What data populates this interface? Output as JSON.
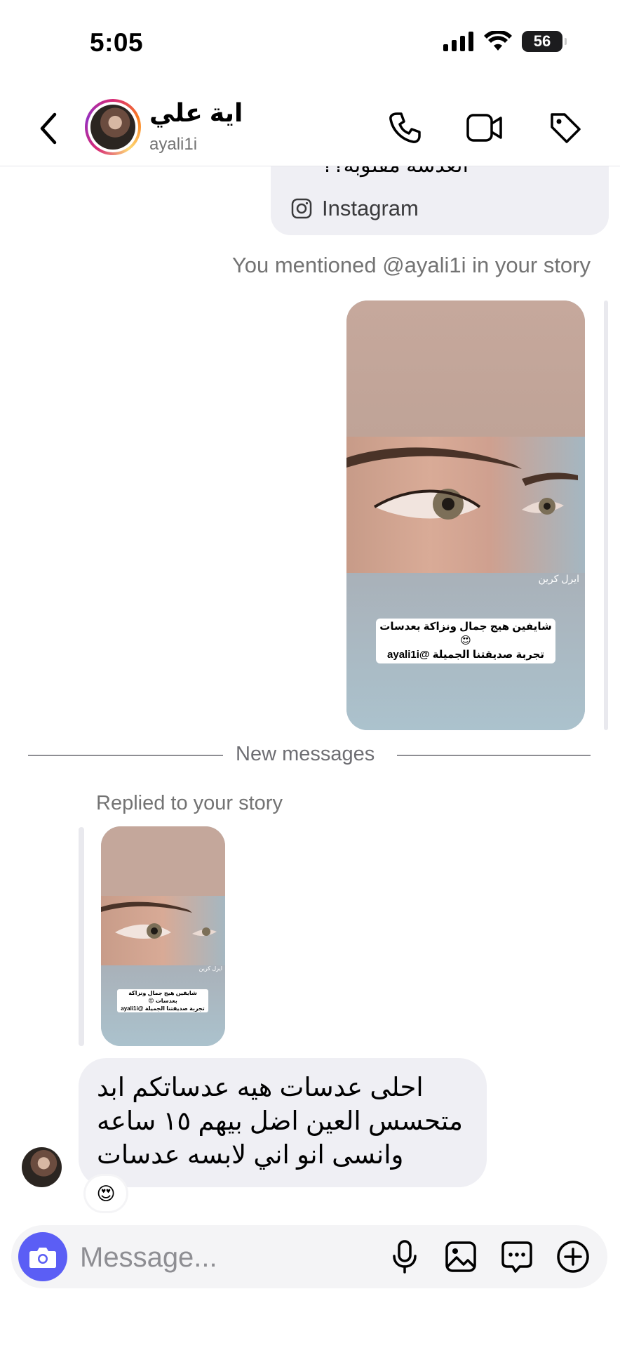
{
  "status_bar": {
    "time": "5:05",
    "battery": "56"
  },
  "header": {
    "name": "اية علي",
    "username": "ayali1i",
    "icons": [
      "back-icon",
      "phone-icon",
      "video-icon",
      "tag-icon"
    ]
  },
  "shared_post": {
    "text": "العدسة مقلوبة؟؟",
    "source": "Instagram"
  },
  "mention_note": "You mentioned @ayali1i in your story",
  "story": {
    "credit": "ايرل كرين",
    "caption_line1": "شايفين هيج جمال ونزاكة بعدسات 😍",
    "caption_line2": "تجربة صديقتنا الجميلة @ayali1i"
  },
  "divider": {
    "label": "New messages"
  },
  "replied_note": "Replied to your story",
  "message": {
    "text": "احلى عدسات هيه عدساتكم ابد متحسس العين اضل بيهم ١٥ ساعه وانسى انو اني لابسه عدسات",
    "reaction": "😍"
  },
  "composer": {
    "placeholder": "Message...",
    "icons": [
      "camera-icon",
      "microphone-icon",
      "image-icon",
      "sticker-icon",
      "plus-icon"
    ]
  },
  "colors": {
    "accent": "#5b5ef5",
    "bubble": "#efeff4",
    "secondary_text": "#737373"
  }
}
